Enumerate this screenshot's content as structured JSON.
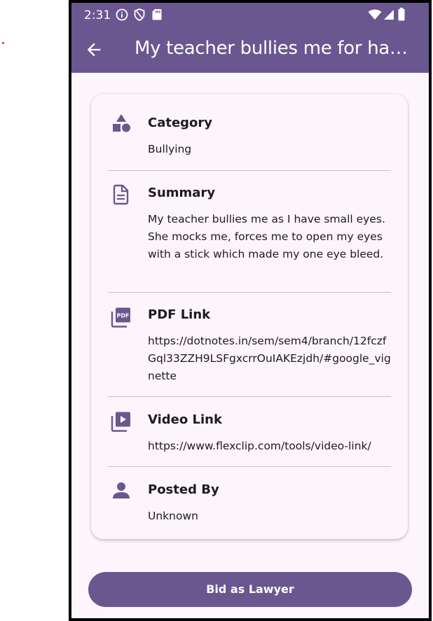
{
  "status_bar": {
    "time": "2:31"
  },
  "app_bar": {
    "title": "My teacher bullies me for having small eyes"
  },
  "details": {
    "category": {
      "label": "Category",
      "value": "Bullying",
      "icon": "category-shapes-icon"
    },
    "summary": {
      "label": "Summary",
      "value": "My teacher bullies me as I have small eyes. She mocks me, forces me to open my eyes with a stick which made my one eye bleed.",
      "icon": "document-icon"
    },
    "pdf_link": {
      "label": "PDF Link",
      "value": "https://dotnotes.in/sem/sem4/branch/12fczfGql33ZZH9LSFgxcrrOuIAKEzjdh/#google_vignette",
      "icon": "pdf-icon"
    },
    "video_link": {
      "label": "Video Link",
      "value": "https://www.flexclip.com/tools/video-link/",
      "icon": "video-library-icon"
    },
    "posted_by": {
      "label": "Posted By",
      "value": "Unknown",
      "icon": "person-icon"
    }
  },
  "actions": {
    "bid_label": "Bid as Lawyer"
  },
  "colors": {
    "primary": "#6a5790",
    "background": "#fdf6fd",
    "card": "#fcf5fb",
    "icon": "#6a5790"
  }
}
